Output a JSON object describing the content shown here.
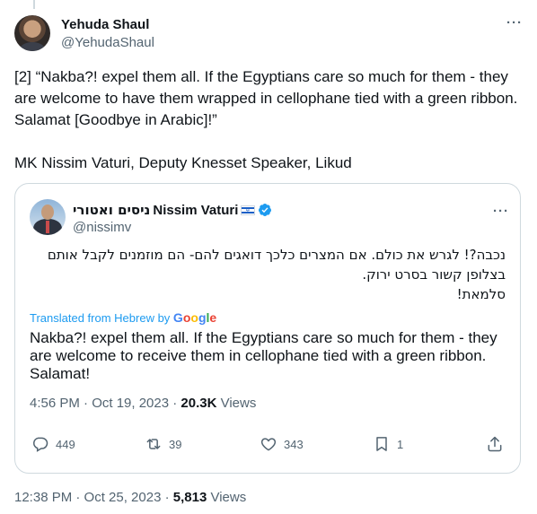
{
  "tweet": {
    "author_name": "Yehuda Shaul",
    "author_handle": "@YehudaShaul",
    "more_label": "···",
    "text_line_1": "[2] “Nakba?! expel them all. If the Egyptians care so much for them - they are welcome to have them wrapped in cellophane tied with a green ribbon. Salamat [Goodbye in Arabic]!”",
    "text_line_2": "MK Nissim Vaturi, Deputy Knesset Speaker, Likud",
    "time": "12:38 PM · Oct 25, 2023 · ",
    "views_count": "5,813",
    "views_label": " Views"
  },
  "quote": {
    "name_hebrew": "ניסים ואטורי",
    "name_english": "Nissim Vaturi",
    "handle": "@nissimv",
    "more_label": "···",
    "hebrew_line_1": "נכבה?! לגרש את כולם. אם המצרים כלכך דואגים להם- הם מוזמנים לקבל אותם בצלופן קשור בסרט ירוק.",
    "hebrew_line_2": "סלמאת!",
    "translated_label": "Translated from Hebrew by ",
    "translated_brand": "Google",
    "translation": "Nakba?! expel them all. If the Egyptians care so much for them - they are welcome to receive them in cellophane tied with a green ribbon. Salamat!",
    "time": "4:56 PM · Oct 19, 2023 · ",
    "views_count": "20.3K",
    "views_label": " Views",
    "actions": {
      "replies": "449",
      "reposts": "39",
      "likes": "343",
      "bookmarks": "1"
    }
  },
  "colors": {
    "accent": "#1d9bf0",
    "secondary_text": "#536471",
    "border": "#cfd9de"
  }
}
